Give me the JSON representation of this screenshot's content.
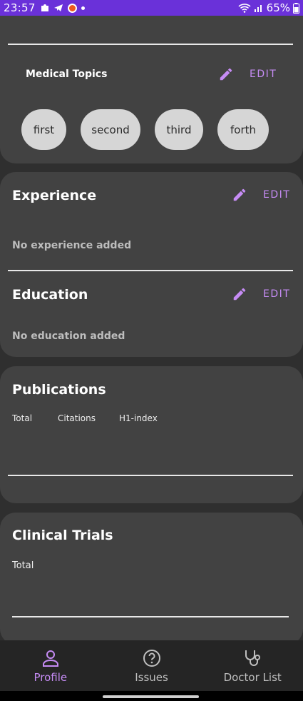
{
  "status_bar": {
    "time": "23:57",
    "battery": "65%",
    "notification_icons": [
      "puzzle-icon",
      "telegram-icon",
      "app-icon",
      "dot-icon"
    ],
    "system_icons": [
      "wifi-icon",
      "signal-icon",
      "battery-icon"
    ]
  },
  "topics": {
    "title": "Medical Topics",
    "edit_label": "EDIT",
    "chips": [
      "first",
      "second",
      "third",
      "forth"
    ]
  },
  "experience": {
    "title": "Experience",
    "edit_label": "EDIT",
    "empty_text": "No experience added"
  },
  "education": {
    "title": "Education",
    "edit_label": "EDIT",
    "empty_text": "No education added"
  },
  "publications": {
    "title": "Publications",
    "stats": [
      "Total",
      "Citations",
      "H1-index"
    ]
  },
  "clinical_trials": {
    "title": "Clinical Trials",
    "total_label": "Total"
  },
  "bottom_nav": {
    "items": [
      {
        "label": "Profile",
        "icon": "person-icon",
        "active": true
      },
      {
        "label": "Issues",
        "icon": "help-circle-icon",
        "active": false
      },
      {
        "label": "Doctor List",
        "icon": "stethoscope-icon",
        "active": false
      }
    ]
  },
  "colors": {
    "accent": "#c68cf5",
    "status_bar": "#6a31d9",
    "background": "#2f2f2f",
    "card": "#424242",
    "chip": "#d6d6d6"
  }
}
